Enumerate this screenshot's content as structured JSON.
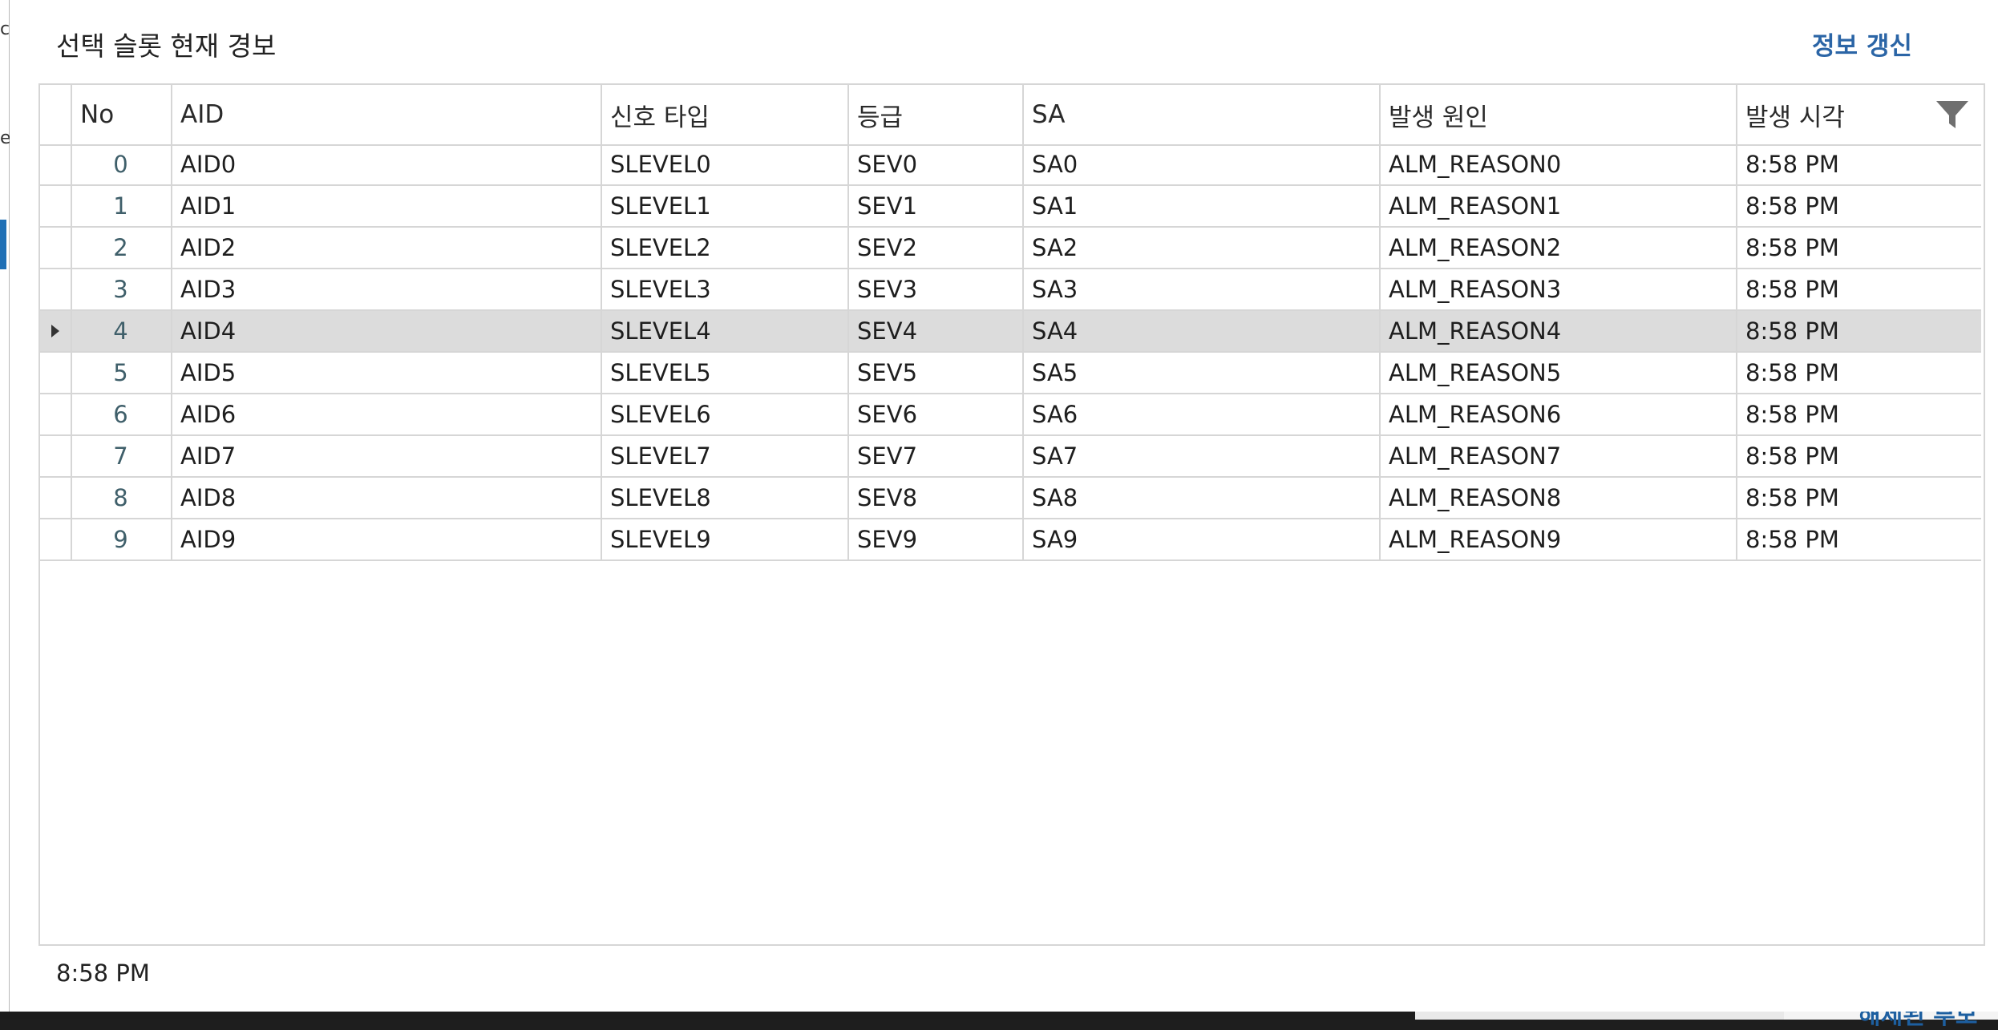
{
  "dialog": {
    "title": "선택 슬롯 현재 경보",
    "refresh_label": "정보 갱신",
    "footer_time": "8:58 PM"
  },
  "background": {
    "left_chars": [
      "c",
      "e"
    ],
    "bottom_text": "해제된 부모"
  },
  "grid": {
    "columns": [
      "No",
      "AID",
      "신호 타입",
      "등급",
      "SA",
      "발생 원인",
      "발생 시각"
    ],
    "selected_row_index": 4,
    "rows": [
      {
        "no": "0",
        "aid": "AID0",
        "type": "SLEVEL0",
        "sev": "SEV0",
        "sa": "SA0",
        "reason": "ALM_REASON0",
        "time": "8:58 PM"
      },
      {
        "no": "1",
        "aid": "AID1",
        "type": "SLEVEL1",
        "sev": "SEV1",
        "sa": "SA1",
        "reason": "ALM_REASON1",
        "time": "8:58 PM"
      },
      {
        "no": "2",
        "aid": "AID2",
        "type": "SLEVEL2",
        "sev": "SEV2",
        "sa": "SA2",
        "reason": "ALM_REASON2",
        "time": "8:58 PM"
      },
      {
        "no": "3",
        "aid": "AID3",
        "type": "SLEVEL3",
        "sev": "SEV3",
        "sa": "SA3",
        "reason": "ALM_REASON3",
        "time": "8:58 PM"
      },
      {
        "no": "4",
        "aid": "AID4",
        "type": "SLEVEL4",
        "sev": "SEV4",
        "sa": "SA4",
        "reason": "ALM_REASON4",
        "time": "8:58 PM"
      },
      {
        "no": "5",
        "aid": "AID5",
        "type": "SLEVEL5",
        "sev": "SEV5",
        "sa": "SA5",
        "reason": "ALM_REASON5",
        "time": "8:58 PM"
      },
      {
        "no": "6",
        "aid": "AID6",
        "type": "SLEVEL6",
        "sev": "SEV6",
        "sa": "SA6",
        "reason": "ALM_REASON6",
        "time": "8:58 PM"
      },
      {
        "no": "7",
        "aid": "AID7",
        "type": "SLEVEL7",
        "sev": "SEV7",
        "sa": "SA7",
        "reason": "ALM_REASON7",
        "time": "8:58 PM"
      },
      {
        "no": "8",
        "aid": "AID8",
        "type": "SLEVEL8",
        "sev": "SEV8",
        "sa": "SA8",
        "reason": "ALM_REASON8",
        "time": "8:58 PM"
      },
      {
        "no": "9",
        "aid": "AID9",
        "type": "SLEVEL9",
        "sev": "SEV9",
        "sa": "SA9",
        "reason": "ALM_REASON9",
        "time": "8:58 PM"
      }
    ]
  },
  "icons": {
    "filter": "filter-icon",
    "row_indicator": "row-indicator-arrow-icon"
  },
  "colors": {
    "accent": "#2b65a6",
    "selected_row": "#dcdcdc",
    "grid_line": "#d6d6d6"
  }
}
